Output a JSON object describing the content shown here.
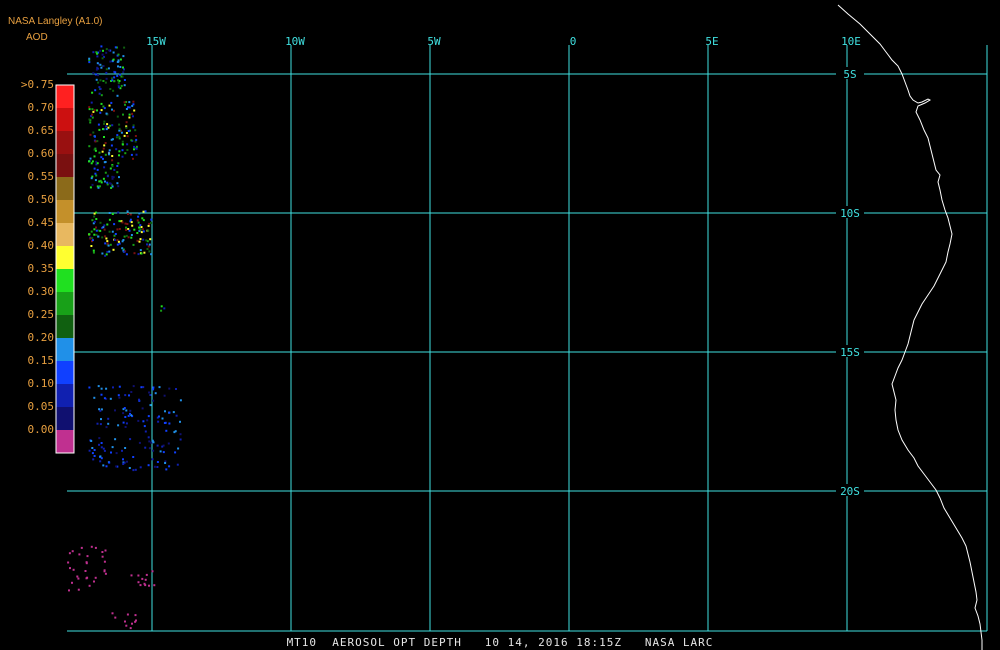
{
  "header": {
    "org_label": "NASA Langley (A1.0)",
    "product_label": "AOD"
  },
  "legend": {
    "entries": [
      {
        "label": ">0.75",
        "color": "#ff2020"
      },
      {
        "label": "0.70",
        "color": "#cc1010"
      },
      {
        "label": "0.65",
        "color": "#991010"
      },
      {
        "label": "0.60",
        "color": "#7a1010"
      },
      {
        "label": "0.55",
        "color": "#8b6a1a"
      },
      {
        "label": "0.50",
        "color": "#c4902a"
      },
      {
        "label": "0.45",
        "color": "#e8b860"
      },
      {
        "label": "0.40",
        "color": "#ffff30"
      },
      {
        "label": "0.35",
        "color": "#20e020"
      },
      {
        "label": "0.30",
        "color": "#18a018"
      },
      {
        "label": "0.25",
        "color": "#106010"
      },
      {
        "label": "0.20",
        "color": "#2090e8"
      },
      {
        "label": "0.15",
        "color": "#1040ff"
      },
      {
        "label": "0.10",
        "color": "#1020b0"
      },
      {
        "label": "0.05",
        "color": "#101070"
      },
      {
        "label": "0.00",
        "color": "#c03090"
      }
    ]
  },
  "map": {
    "grid_color": "#40e0e0",
    "coast_color": "#ffffff",
    "longitude_labels": [
      "15W",
      "10W",
      "5W",
      "0",
      "5E",
      "10E"
    ],
    "latitude_labels": [
      "5S",
      "10S",
      "15S",
      "20S"
    ]
  },
  "footer": {
    "caption": "MT10  AEROSOL OPT DEPTH   10 14, 2016 18:15Z   NASA LARC"
  }
}
